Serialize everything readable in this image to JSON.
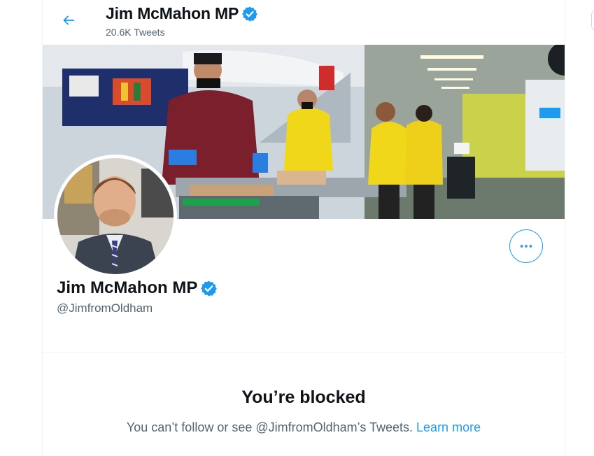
{
  "header": {
    "title": "Jim McMahon MP",
    "tweet_count": "20.6K Tweets",
    "back_icon": "arrow-left-icon"
  },
  "profile": {
    "display_name": "Jim McMahon MP",
    "handle": "@JimfromOldham",
    "verified": true,
    "verified_icon": "verified-badge-icon",
    "more_icon": "more-horizontal-icon"
  },
  "blocked": {
    "title": "You’re blocked",
    "message": "You can’t follow or see @JimfromOldham’s Tweets.",
    "learn_more": "Learn more"
  },
  "colors": {
    "accent": "#1d9bf0",
    "text_primary": "#0f1419",
    "text_secondary": "#536471",
    "border": "#eff3f4"
  }
}
